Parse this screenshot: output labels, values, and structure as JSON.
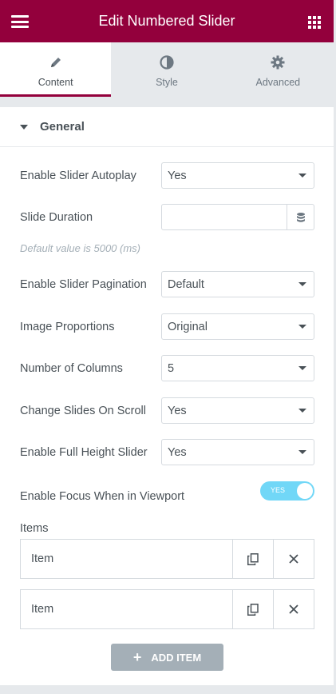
{
  "header": {
    "title": "Edit Numbered Slider"
  },
  "tabs": [
    {
      "label": "Content",
      "icon": "pencil-icon",
      "active": true
    },
    {
      "label": "Style",
      "icon": "half-circle-icon",
      "active": false
    },
    {
      "label": "Advanced",
      "icon": "gear-icon",
      "active": false
    }
  ],
  "section": {
    "title": "General"
  },
  "fields": {
    "autoplay": {
      "label": "Enable Slider Autoplay",
      "value": "Yes"
    },
    "duration": {
      "label": "Slide Duration",
      "value": "",
      "description": "Default value is 5000 (ms)"
    },
    "pagination": {
      "label": "Enable Slider Pagination",
      "value": "Default"
    },
    "proportions": {
      "label": "Image Proportions",
      "value": "Original"
    },
    "columns": {
      "label": "Number of Columns",
      "value": "5"
    },
    "scroll": {
      "label": "Change Slides On Scroll",
      "value": "Yes"
    },
    "fullheight": {
      "label": "Enable Full Height Slider",
      "value": "Yes"
    },
    "focus": {
      "label": "Enable Focus When in Viewport",
      "toggle_text": "YES",
      "on": true
    }
  },
  "items": {
    "label": "Items",
    "list": [
      {
        "label": "Item"
      },
      {
        "label": "Item"
      }
    ],
    "add_label": "ADD ITEM"
  },
  "colors": {
    "accent": "#93003c",
    "toggle_on": "#71d7f7",
    "add_button": "#a4afb7"
  }
}
